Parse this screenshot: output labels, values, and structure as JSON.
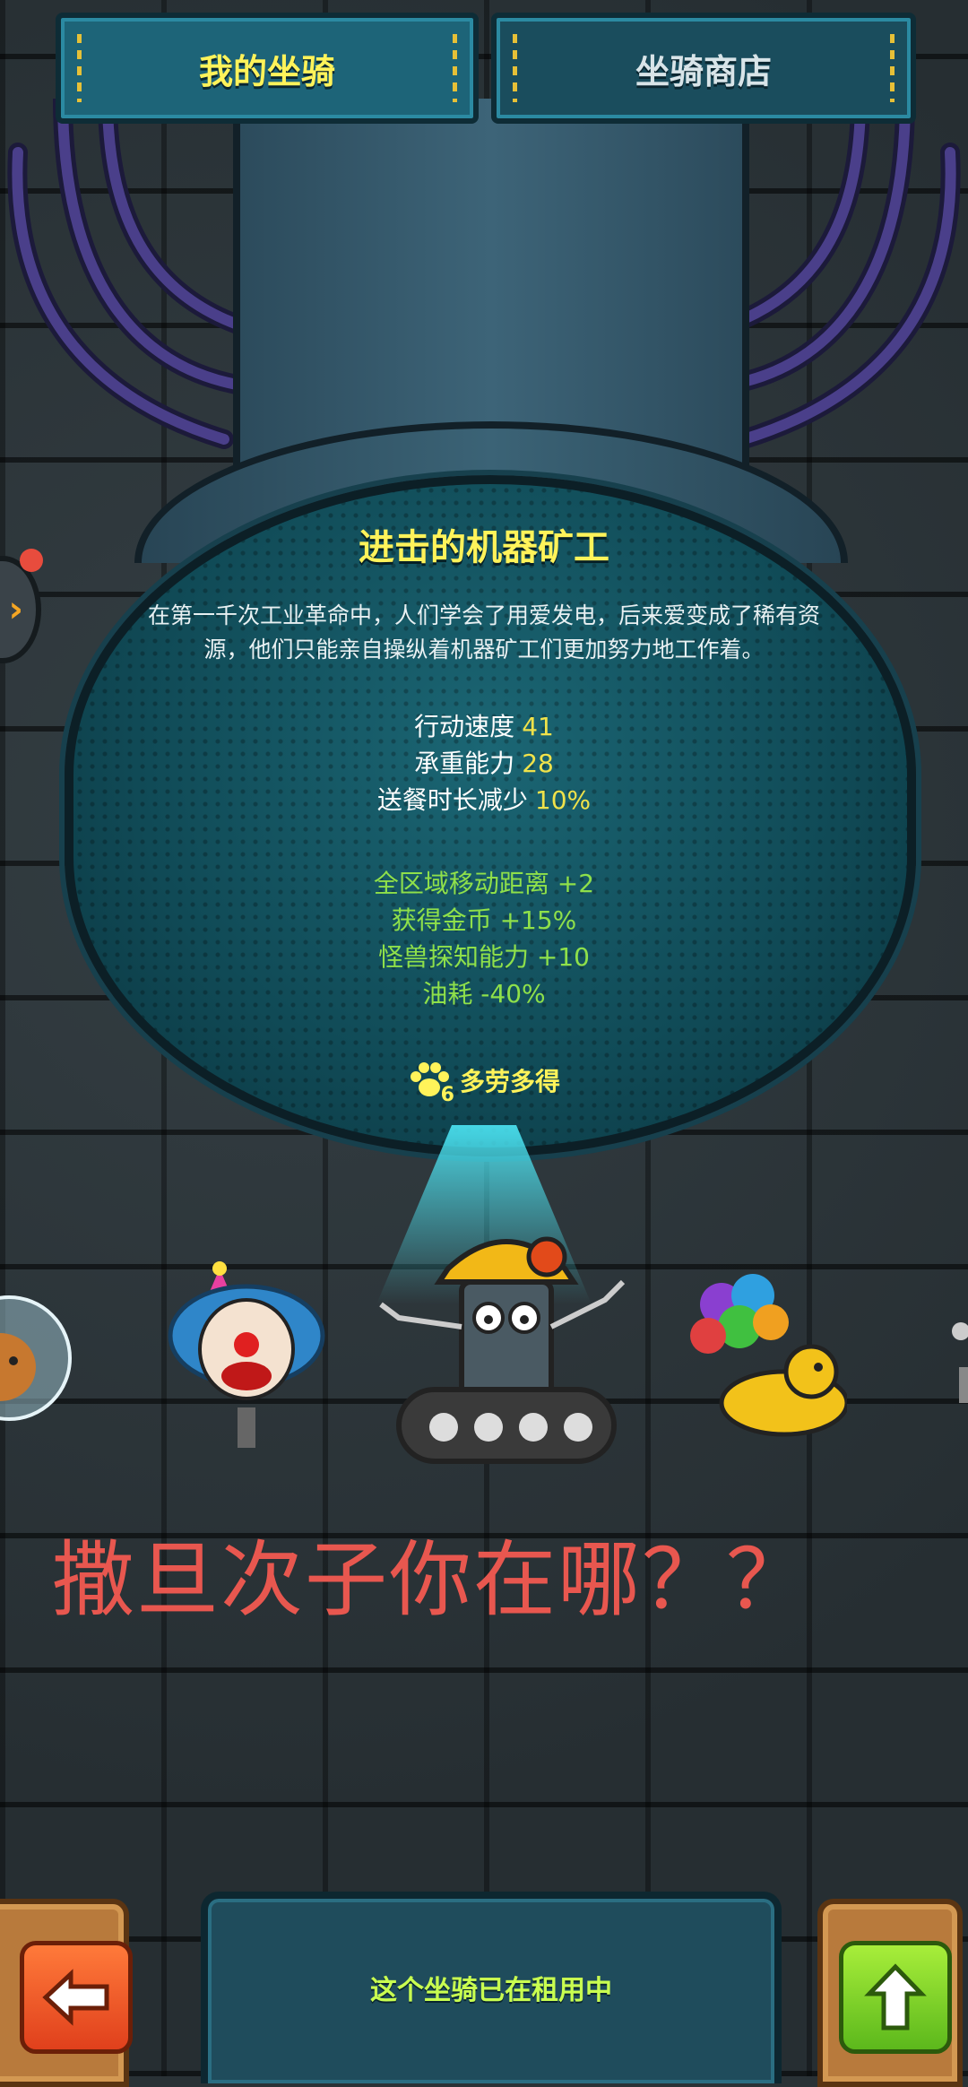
{
  "tabs": {
    "my_mounts": "我的坐骑",
    "mount_shop": "坐骑商店"
  },
  "mount": {
    "name": "进击的机器矿工",
    "description": "在第一千次工业革命中，人们学会了用爱发电，后来爱变成了稀有资源，他们只能亲自操纵着机器矿工们更加努力地工作着。",
    "stats": [
      {
        "label": "行动速度",
        "value": "41"
      },
      {
        "label": "承重能力",
        "value": "28"
      },
      {
        "label": "送餐时长减少",
        "value": "10%"
      }
    ],
    "bonuses": [
      "全区域移动距离 +2",
      "获得金币 +15%",
      "怪兽探知能力 +10",
      "油耗 -40%"
    ],
    "skill": {
      "level": "6",
      "label": "多劳多得",
      "icon": "paw-icon"
    }
  },
  "overlay_text": "撒旦次子你在哪？？",
  "status": "这个坐骑已在租用中",
  "buttons": {
    "back_icon": "arrow-left-icon",
    "up_icon": "arrow-up-icon"
  },
  "colors": {
    "title_yellow": "#fff35a",
    "bonus_green": "#8fe04a",
    "overlay_red": "#e8574f",
    "status_green": "#c9ff50"
  }
}
